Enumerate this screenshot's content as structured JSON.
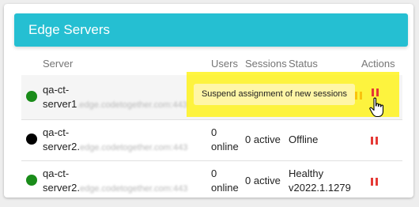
{
  "card": {
    "title": "Edge Servers"
  },
  "table": {
    "columns": [
      "Server",
      "Users",
      "Sessions",
      "Status",
      "Actions"
    ],
    "rows": [
      {
        "status_color": "#1a8c1a",
        "server_line1": "qa-ct-",
        "server_line2": "server1",
        "server_domain": ".edge.codetogether.com:443",
        "users_line1": "",
        "users_line2": "",
        "sessions": "",
        "status_line1": "",
        "status_line2": "",
        "action_icon": "pause-icon"
      },
      {
        "status_color": "#000000",
        "server_line1": "qa-ct-",
        "server_line2": "server2.",
        "server_domain": "edge.codetogether.com:443",
        "users_line1": "0",
        "users_line2": "online",
        "sessions": "0 active",
        "status_line1": "Offline",
        "status_line2": "",
        "action_icon": "pause-icon"
      },
      {
        "status_color": "#1a8c1a",
        "server_line1": "qa-ct-",
        "server_line2": "server2.",
        "server_domain": "edge.codetogether.com:443",
        "users_line1": "0",
        "users_line2": "online",
        "sessions": "0 active",
        "status_line1": "Healthy",
        "status_line2": "v2022.1.1279",
        "action_icon": "pause-icon"
      }
    ]
  },
  "tooltip": {
    "text": "Suspend assignment of new sessions"
  },
  "colors": {
    "header": "#25bfd2",
    "pause": "#e53935",
    "highlight": "#fff200"
  }
}
